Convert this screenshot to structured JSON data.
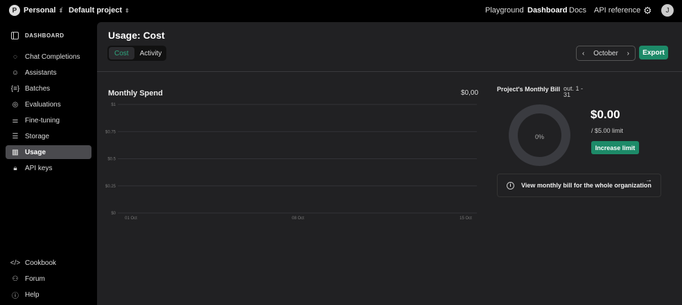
{
  "topbar": {
    "avatar": "P",
    "org": "Personal",
    "sep": "/",
    "project": "Default project",
    "nav": [
      "Playground",
      "Dashboard",
      "Docs",
      "API reference"
    ],
    "user_avatar": "J"
  },
  "sidebar": {
    "header": "DASHBOARD",
    "items": [
      {
        "label": "Chat Completions",
        "icon": "chat-icon"
      },
      {
        "label": "Assistants",
        "icon": "assistant-icon"
      },
      {
        "label": "Batches",
        "icon": "batches-icon"
      },
      {
        "label": "Evaluations",
        "icon": "evaluations-icon"
      },
      {
        "label": "Fine-tuning",
        "icon": "sliders-icon"
      },
      {
        "label": "Storage",
        "icon": "database-icon"
      },
      {
        "label": "Usage",
        "icon": "bar-chart-icon",
        "active": true
      },
      {
        "label": "API keys",
        "icon": "lock-icon"
      }
    ],
    "footer": [
      {
        "label": "Cookbook",
        "icon": "code-icon"
      },
      {
        "label": "Forum",
        "icon": "users-icon"
      },
      {
        "label": "Help",
        "icon": "help-icon"
      }
    ]
  },
  "main": {
    "title": "Usage: Cost",
    "tabs": [
      "Cost",
      "Activity"
    ],
    "month": "October",
    "export": "Export"
  },
  "chart_data": {
    "type": "line",
    "title": "Monthly Spend",
    "total": "$0,00",
    "y_ticks": [
      "$0",
      "$0.25",
      "$0.5",
      "$0.75",
      "$1"
    ],
    "ylim": [
      0,
      1
    ],
    "x_ticks": [
      "01 Oct",
      "08 Oct",
      "15 Oct"
    ],
    "series": [],
    "grid": true
  },
  "bill": {
    "title": "Project's Monthly Bill",
    "range": "out. 1 - 31",
    "percent": "0%",
    "percent_value": 0,
    "amount": "$0.00",
    "limit": "/ $5.00 limit",
    "increase": "Increase limit",
    "org_link": "View monthly bill for the whole organization"
  },
  "colors": {
    "accent": "#1d8a68",
    "active_tab": "#2ea77f"
  }
}
